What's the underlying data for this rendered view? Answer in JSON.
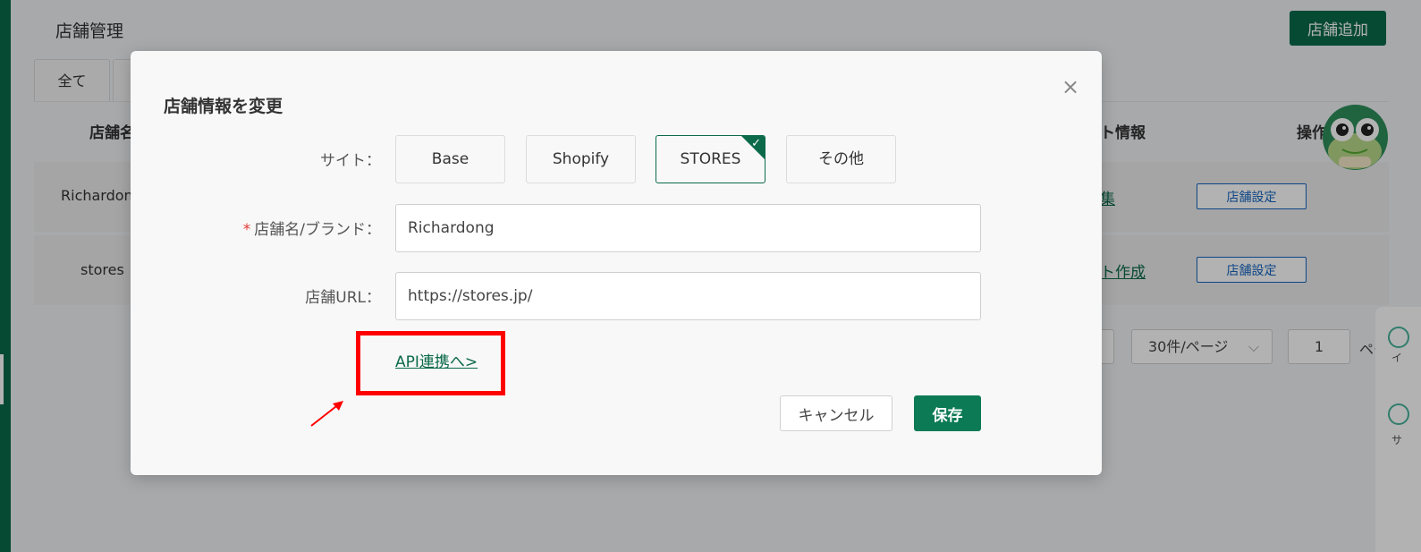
{
  "page": {
    "title": "店舗管理",
    "add_store_label": "店舗追加",
    "tabs": [
      {
        "label": "全て"
      },
      {
        "label": ""
      }
    ],
    "table": {
      "headers": {
        "store_name": "店舗名",
        "info": "ト情報",
        "actions": "操作"
      },
      "rows": [
        {
          "store_name": "Richardon",
          "link": "集",
          "action": "店舗設定"
        },
        {
          "store_name": "stores",
          "link": "ト作成",
          "action": "店舗設定"
        }
      ]
    },
    "pagination": {
      "page_size": "30件/ページ",
      "current_page": "1",
      "suffix": "ペー"
    },
    "right_panel": {
      "items": [
        "イ",
        "サ"
      ]
    }
  },
  "modal": {
    "title": "店舗情報を変更",
    "site_label": "サイト：",
    "site_options": [
      {
        "label": "Base",
        "selected": false
      },
      {
        "label": "Shopify",
        "selected": false
      },
      {
        "label": "STORES",
        "selected": true
      },
      {
        "label": "その他",
        "selected": false
      }
    ],
    "store_name_label": "店舗名/ブランド：",
    "store_name_required": "*",
    "store_name_value": "Richardong",
    "store_url_label": "店舗URL：",
    "store_url_value": "https://stores.jp/",
    "api_link_label": "API連携へ>",
    "cancel_label": "キャンセル",
    "save_label": "保存"
  },
  "colors": {
    "brand": "#0b6a4a",
    "annotation": "#ff0000",
    "link_blue": "#1565c0"
  },
  "icons": {
    "close": "close-icon",
    "check": "check-icon",
    "arrow": "annotation-arrow-icon"
  }
}
